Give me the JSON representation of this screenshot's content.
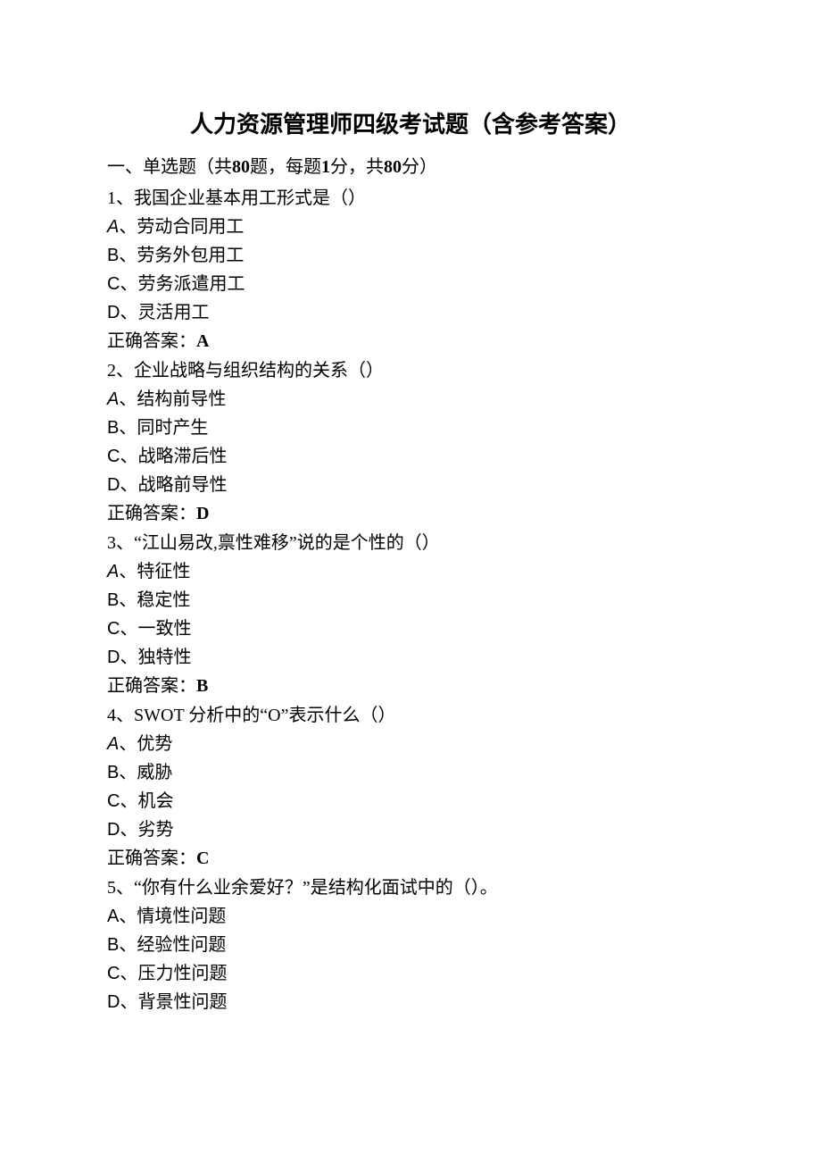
{
  "title": "人力资源管理师四级考试题（含参考答案）",
  "section": {
    "label_prefix": "一、单选题（共",
    "count1": "80",
    "label_mid1": "题，每题",
    "per": "1",
    "label_mid2": "分，共",
    "count2": "80",
    "label_suffix": "分）"
  },
  "answer_label": "正确答案：",
  "questions": [
    {
      "num": "1、",
      "text": "我国企业基本用工形式是（）",
      "options": [
        {
          "letter": "A",
          "sep": "、",
          "text": "劳动合同用工",
          "sans": true
        },
        {
          "letter": "B",
          "sep": "、",
          "text": "劳务外包用工"
        },
        {
          "letter": "C",
          "sep": "、",
          "text": "劳务派遣用工"
        },
        {
          "letter": "D",
          "sep": "、",
          "text": "灵活用工"
        }
      ],
      "answer": "A"
    },
    {
      "num": "2、",
      "text": "企业战略与组织结构的关系（）",
      "options": [
        {
          "letter": "A",
          "sep": "、",
          "text": "结构前导性",
          "sans": true
        },
        {
          "letter": "B",
          "sep": "、",
          "text": "同时产生"
        },
        {
          "letter": "C",
          "sep": "、",
          "text": "战略滞后性"
        },
        {
          "letter": "D",
          "sep": "、",
          "text": "战略前导性"
        }
      ],
      "answer": "D"
    },
    {
      "num": "3、",
      "text": "“江山易改,禀性难移”说的是个性的（）",
      "options": [
        {
          "letter": "A",
          "sep": "、",
          "text": "特征性",
          "sans": true
        },
        {
          "letter": "B",
          "sep": "、",
          "text": "稳定性"
        },
        {
          "letter": "C",
          "sep": "、",
          "text": "一致性"
        },
        {
          "letter": "D",
          "sep": "、",
          "text": "独特性"
        }
      ],
      "answer": "B"
    },
    {
      "num": "4、",
      "text": "SWOT 分析中的“O”表示什么（）",
      "options": [
        {
          "letter": "A",
          "sep": "、",
          "text": "优势",
          "sans": true
        },
        {
          "letter": "B",
          "sep": "、",
          "text": "威胁"
        },
        {
          "letter": "C",
          "sep": "、",
          "text": "机会"
        },
        {
          "letter": "D",
          "sep": "、",
          "text": "劣势"
        }
      ],
      "answer": "C"
    },
    {
      "num": "5、",
      "text": "“你有什么业余爱好？”是结构化面试中的（）。",
      "options": [
        {
          "letter": "A",
          "sep": "、",
          "text": "情境性问题"
        },
        {
          "letter": "B",
          "sep": "、",
          "text": "经验性问题"
        },
        {
          "letter": "C",
          "sep": "、",
          "text": "压力性问题"
        },
        {
          "letter": "D",
          "sep": "、",
          "text": "背景性问题"
        }
      ]
    }
  ]
}
